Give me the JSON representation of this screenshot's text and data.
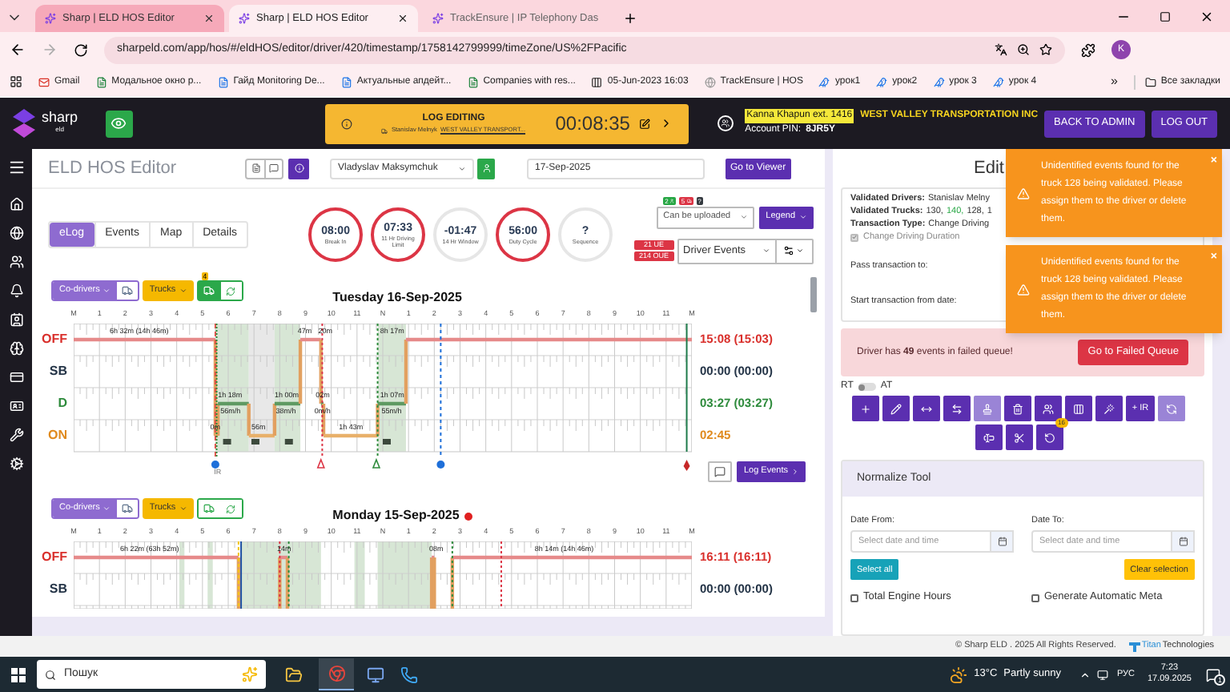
{
  "browser": {
    "tabs": [
      {
        "title": "Sharp | ELD HOS Editor",
        "selected": false
      },
      {
        "title": "Sharp | ELD HOS Editor",
        "selected": true
      },
      {
        "title": "TrackEnsure | IP Telephony Das",
        "selected": false
      }
    ],
    "url": "sharpeld.com/app/hos/#/eldHOS/editor/driver/420/timestamp/1758142799999/timeZone/US%2FPacific",
    "profile": "K",
    "bookmarks": [
      "Gmail",
      "Модальное окно р...",
      "Гайд Monitoring De...",
      "Актуальные апдейт...",
      "Companies with res...",
      "05-Jun-2023 16:03",
      "TrackEnsure | HOS",
      "урок1",
      "урок2",
      "урок 3",
      "урок 4"
    ],
    "overflow": "»",
    "all_bookmarks": "Все закладки"
  },
  "header": {
    "logo": "sharp",
    "logo_sub": "eld",
    "log_editing": {
      "title": "LOG EDITING",
      "driver": "Stanislav Melnyk",
      "company": "WEST VALLEY TRANSPORT...",
      "timer": "00:08:35"
    },
    "user": "Kanna Khapun ext. 1416",
    "company": "WEST VALLEY TRANSPORTATION INC",
    "pin_label": "Account PIN:",
    "pin": "8JR5Y",
    "buttons": [
      "BACK TO ADMIN",
      "LOG OUT"
    ]
  },
  "editor": {
    "title": "ELD HOS Editor",
    "driver": "Vladyslav Maksymchuk",
    "date": "17-Sep-2025",
    "viewer_button": "Go to Viewer",
    "tabs": [
      {
        "label": "eLog",
        "selected": true
      },
      {
        "label": "Events",
        "selected": false
      },
      {
        "label": "Map",
        "selected": false
      },
      {
        "label": "Details",
        "selected": false
      }
    ],
    "gauges": [
      {
        "value": "08:00",
        "label": "Break In",
        "color": "#dc3545"
      },
      {
        "value": "07:33",
        "label": "11 Hr Driving Limit",
        "color": "#dc3545"
      },
      {
        "value": "-01:47",
        "label": "14 Hr Window",
        "color": "#e6e6e6"
      },
      {
        "value": "56:00",
        "label": "Duty Cycle",
        "color": "#dc3545"
      },
      {
        "value": "?",
        "label": "Sequence",
        "color": "#e6e6e6"
      }
    ],
    "upload_badges": [
      {
        "text": "2",
        "kind": "drivers",
        "color": "#28a745"
      },
      {
        "text": "5",
        "kind": "trucks",
        "color": "#dc3545"
      },
      {
        "text": "?",
        "kind": "plain",
        "color": "#343a40"
      }
    ],
    "upload_select": "Can be uploaded",
    "legend_button": "Legend",
    "ue_badges": [
      "21 UE",
      "214 OUE"
    ],
    "events_select": "Driver Events",
    "days": [
      {
        "title": "Tuesday 16-Sep-2025",
        "alert_dot": false,
        "co_drivers": "Co-drivers",
        "trucks": "Trucks",
        "tools_active": true,
        "tools_badge": "4",
        "hour_labels": [
          "M",
          "1",
          "2",
          "3",
          "4",
          "5",
          "6",
          "7",
          "8",
          "9",
          "10",
          "11",
          "N",
          "1",
          "2",
          "3",
          "4",
          "5",
          "6",
          "7",
          "8",
          "9",
          "10",
          "11",
          "M"
        ],
        "rows": [
          {
            "label": "OFF",
            "total": "15:08 (15:03)",
            "color": "#d9302c"
          },
          {
            "label": "SB",
            "total": "00:00 (00:00)",
            "color": "#243447"
          },
          {
            "label": "D",
            "total": "03:27 (03:27)",
            "color": "#2e8b3c"
          },
          {
            "label": "ON",
            "total": "02:45",
            "color": "#e08a1e"
          }
        ],
        "segment_labels": [
          "6h 32m (14h 46m)",
          "47m",
          "20m",
          "8h 17m",
          "1h 18m",
          "56m/h",
          "1h 00m",
          "38m/h",
          "02m",
          "0m/h",
          "1h 07m",
          "55m/h",
          "0m",
          "56m",
          "1h 43m"
        ],
        "marker_label": "IR",
        "log_events_button": "Log Events"
      },
      {
        "title": "Monday 15-Sep-2025",
        "alert_dot": true,
        "co_drivers": "Co-drivers",
        "trucks": "Trucks",
        "tools_active": false,
        "hour_labels": [
          "M",
          "1",
          "2",
          "3",
          "4",
          "5",
          "6",
          "7",
          "8",
          "9",
          "10",
          "11",
          "N",
          "1",
          "2",
          "3",
          "4",
          "5",
          "6",
          "7",
          "8",
          "9",
          "10",
          "11",
          "M"
        ],
        "rows": [
          {
            "label": "OFF",
            "total": "16:11 (16:11)",
            "color": "#d9302c"
          },
          {
            "label": "SB",
            "total": "00:00 (00:00)",
            "color": "#243447"
          }
        ],
        "segment_labels": [
          "6h 22m (63h 52m)",
          "14m",
          "08m",
          "8h 14m (14h 46m)"
        ]
      }
    ]
  },
  "edit_panel": {
    "title": "Edit",
    "drivers_label": "Validated Drivers:",
    "drivers": "Stanislav Melny",
    "trucks_label": "Validated Trucks:",
    "trucks": [
      {
        "text": "130,",
        "validated": false
      },
      {
        "text": "140,",
        "validated": true
      },
      {
        "text": "128,",
        "validated": false
      },
      {
        "text": "1",
        "validated": false
      }
    ],
    "type_label": "Transaction Type:",
    "type": "Change Driving",
    "duration_checkbox": {
      "label": "Change Driving Duration",
      "checked": true,
      "disabled": true
    },
    "pass_label": "Pass transaction to:",
    "start_label": "Start transaction from date:",
    "failed_queue": {
      "message": "Driver has **49** events in failed queue!",
      "button": "Go to Failed Queue"
    },
    "mode": {
      "left": "RT",
      "right": "AT",
      "on": false
    },
    "tools": [
      {
        "disabled": false
      },
      {
        "disabled": false
      },
      {
        "disabled": false
      },
      {
        "disabled": false
      },
      {
        "disabled": true
      },
      {
        "disabled": false
      },
      {
        "disabled": false
      },
      {
        "disabled": false
      },
      {
        "disabled": false
      },
      {
        "label": "+ IR",
        "disabled": false
      },
      {
        "disabled": true
      },
      {
        "disabled": false
      },
      {
        "disabled": false
      },
      {
        "badge": "16",
        "disabled": false
      }
    ],
    "normalize": {
      "title": "Normalize Tool",
      "from_label": "Date From:",
      "to_label": "Date To:",
      "from_placeholder": "Select date and time",
      "to_placeholder": "Select date and time",
      "select_all": "Select all",
      "clear": "Clear selection",
      "options": [
        {
          "label": "Total Engine Hours",
          "checked": false
        },
        {
          "label": "Generate Automatic Meta",
          "checked": false
        }
      ]
    }
  },
  "toasts": [
    {
      "message": "Unidentified events found for the truck 128 being validated. Please assign them to the driver or delete them.",
      "close": "×"
    },
    {
      "message": "Unidentified events found for the truck 128 being validated. Please assign them to the driver or delete them.",
      "close": "×"
    }
  ],
  "footer": {
    "copyright": "© Sharp ELD . 2025 All Rights Reserved.",
    "brand": "Titan",
    "brand_rest": "Technologies"
  },
  "taskbar": {
    "search": "Пошук",
    "temperature": "13°C",
    "weather": "Partly sunny",
    "lang": "РУС",
    "time": "7:23",
    "date": "17.09.2025",
    "notifications": "1"
  }
}
